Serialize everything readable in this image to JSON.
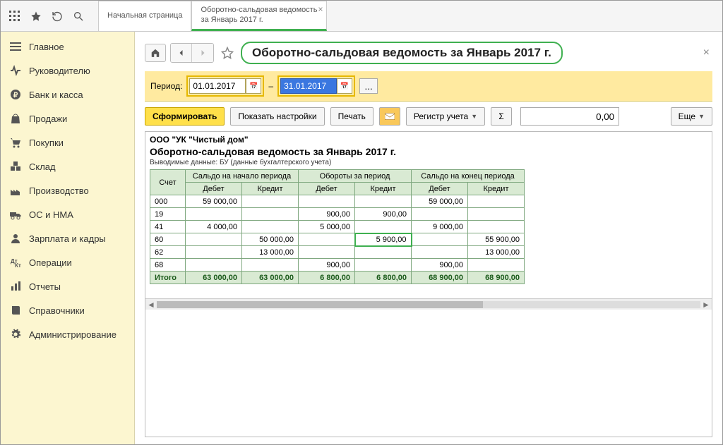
{
  "topbar": {
    "tab_home": "Начальная страница",
    "tab_active_line1": "Оборотно-сальдовая ведомость",
    "tab_active_line2": "за Январь 2017 г."
  },
  "sidebar": {
    "items": [
      {
        "label": "Главное",
        "icon": "menu"
      },
      {
        "label": "Руководителю",
        "icon": "pulse"
      },
      {
        "label": "Банк и касса",
        "icon": "ruble"
      },
      {
        "label": "Продажи",
        "icon": "bag"
      },
      {
        "label": "Покупки",
        "icon": "cart"
      },
      {
        "label": "Склад",
        "icon": "boxes"
      },
      {
        "label": "Производство",
        "icon": "factory"
      },
      {
        "label": "ОС и НМА",
        "icon": "truck"
      },
      {
        "label": "Зарплата и кадры",
        "icon": "person"
      },
      {
        "label": "Операции",
        "icon": "ops"
      },
      {
        "label": "Отчеты",
        "icon": "chart"
      },
      {
        "label": "Справочники",
        "icon": "book"
      },
      {
        "label": "Администрирование",
        "icon": "gear"
      }
    ]
  },
  "page": {
    "title": "Оборотно-сальдовая ведомость за Январь 2017 г."
  },
  "period": {
    "label": "Период:",
    "from": "01.01.2017",
    "sep": "–",
    "to": "31.01.2017"
  },
  "toolbar": {
    "form": "Сформировать",
    "settings": "Показать настройки",
    "print": "Печать",
    "register": "Регистр учета",
    "sigma": "Σ",
    "sum_value": "0,00",
    "more": "Еще"
  },
  "report": {
    "org": "ООО \"УК \"Чистый дом\"",
    "title": "Оборотно-сальдовая ведомость за Январь 2017 г.",
    "subtitle": "Выводимые данные:   БУ (данные бухгалтерского учета)",
    "headers": {
      "acct": "Счет",
      "group1": "Сальдо на начало периода",
      "group2": "Обороты за период",
      "group3": "Сальдо на конец периода",
      "debit": "Дебет",
      "credit": "Кредит"
    },
    "rows": [
      {
        "acct": "000",
        "sd": "59 000,00",
        "sc": "",
        "od": "",
        "oc": "",
        "ed": "59 000,00",
        "ec": ""
      },
      {
        "acct": "19",
        "sd": "",
        "sc": "",
        "od": "900,00",
        "oc": "900,00",
        "ed": "",
        "ec": ""
      },
      {
        "acct": "41",
        "sd": "4 000,00",
        "sc": "",
        "od": "5 000,00",
        "oc": "",
        "ed": "9 000,00",
        "ec": ""
      },
      {
        "acct": "60",
        "sd": "",
        "sc": "50 000,00",
        "od": "",
        "oc": "5 900,00",
        "ed": "",
        "ec": "55 900,00",
        "hl_oc": true
      },
      {
        "acct": "62",
        "sd": "",
        "sc": "13 000,00",
        "od": "",
        "oc": "",
        "ed": "",
        "ec": "13 000,00"
      },
      {
        "acct": "68",
        "sd": "",
        "sc": "",
        "od": "900,00",
        "oc": "",
        "ed": "900,00",
        "ec": ""
      }
    ],
    "total": {
      "label": "Итого",
      "sd": "63 000,00",
      "sc": "63 000,00",
      "od": "6 800,00",
      "oc": "6 800,00",
      "ed": "68 900,00",
      "ec": "68 900,00"
    }
  }
}
